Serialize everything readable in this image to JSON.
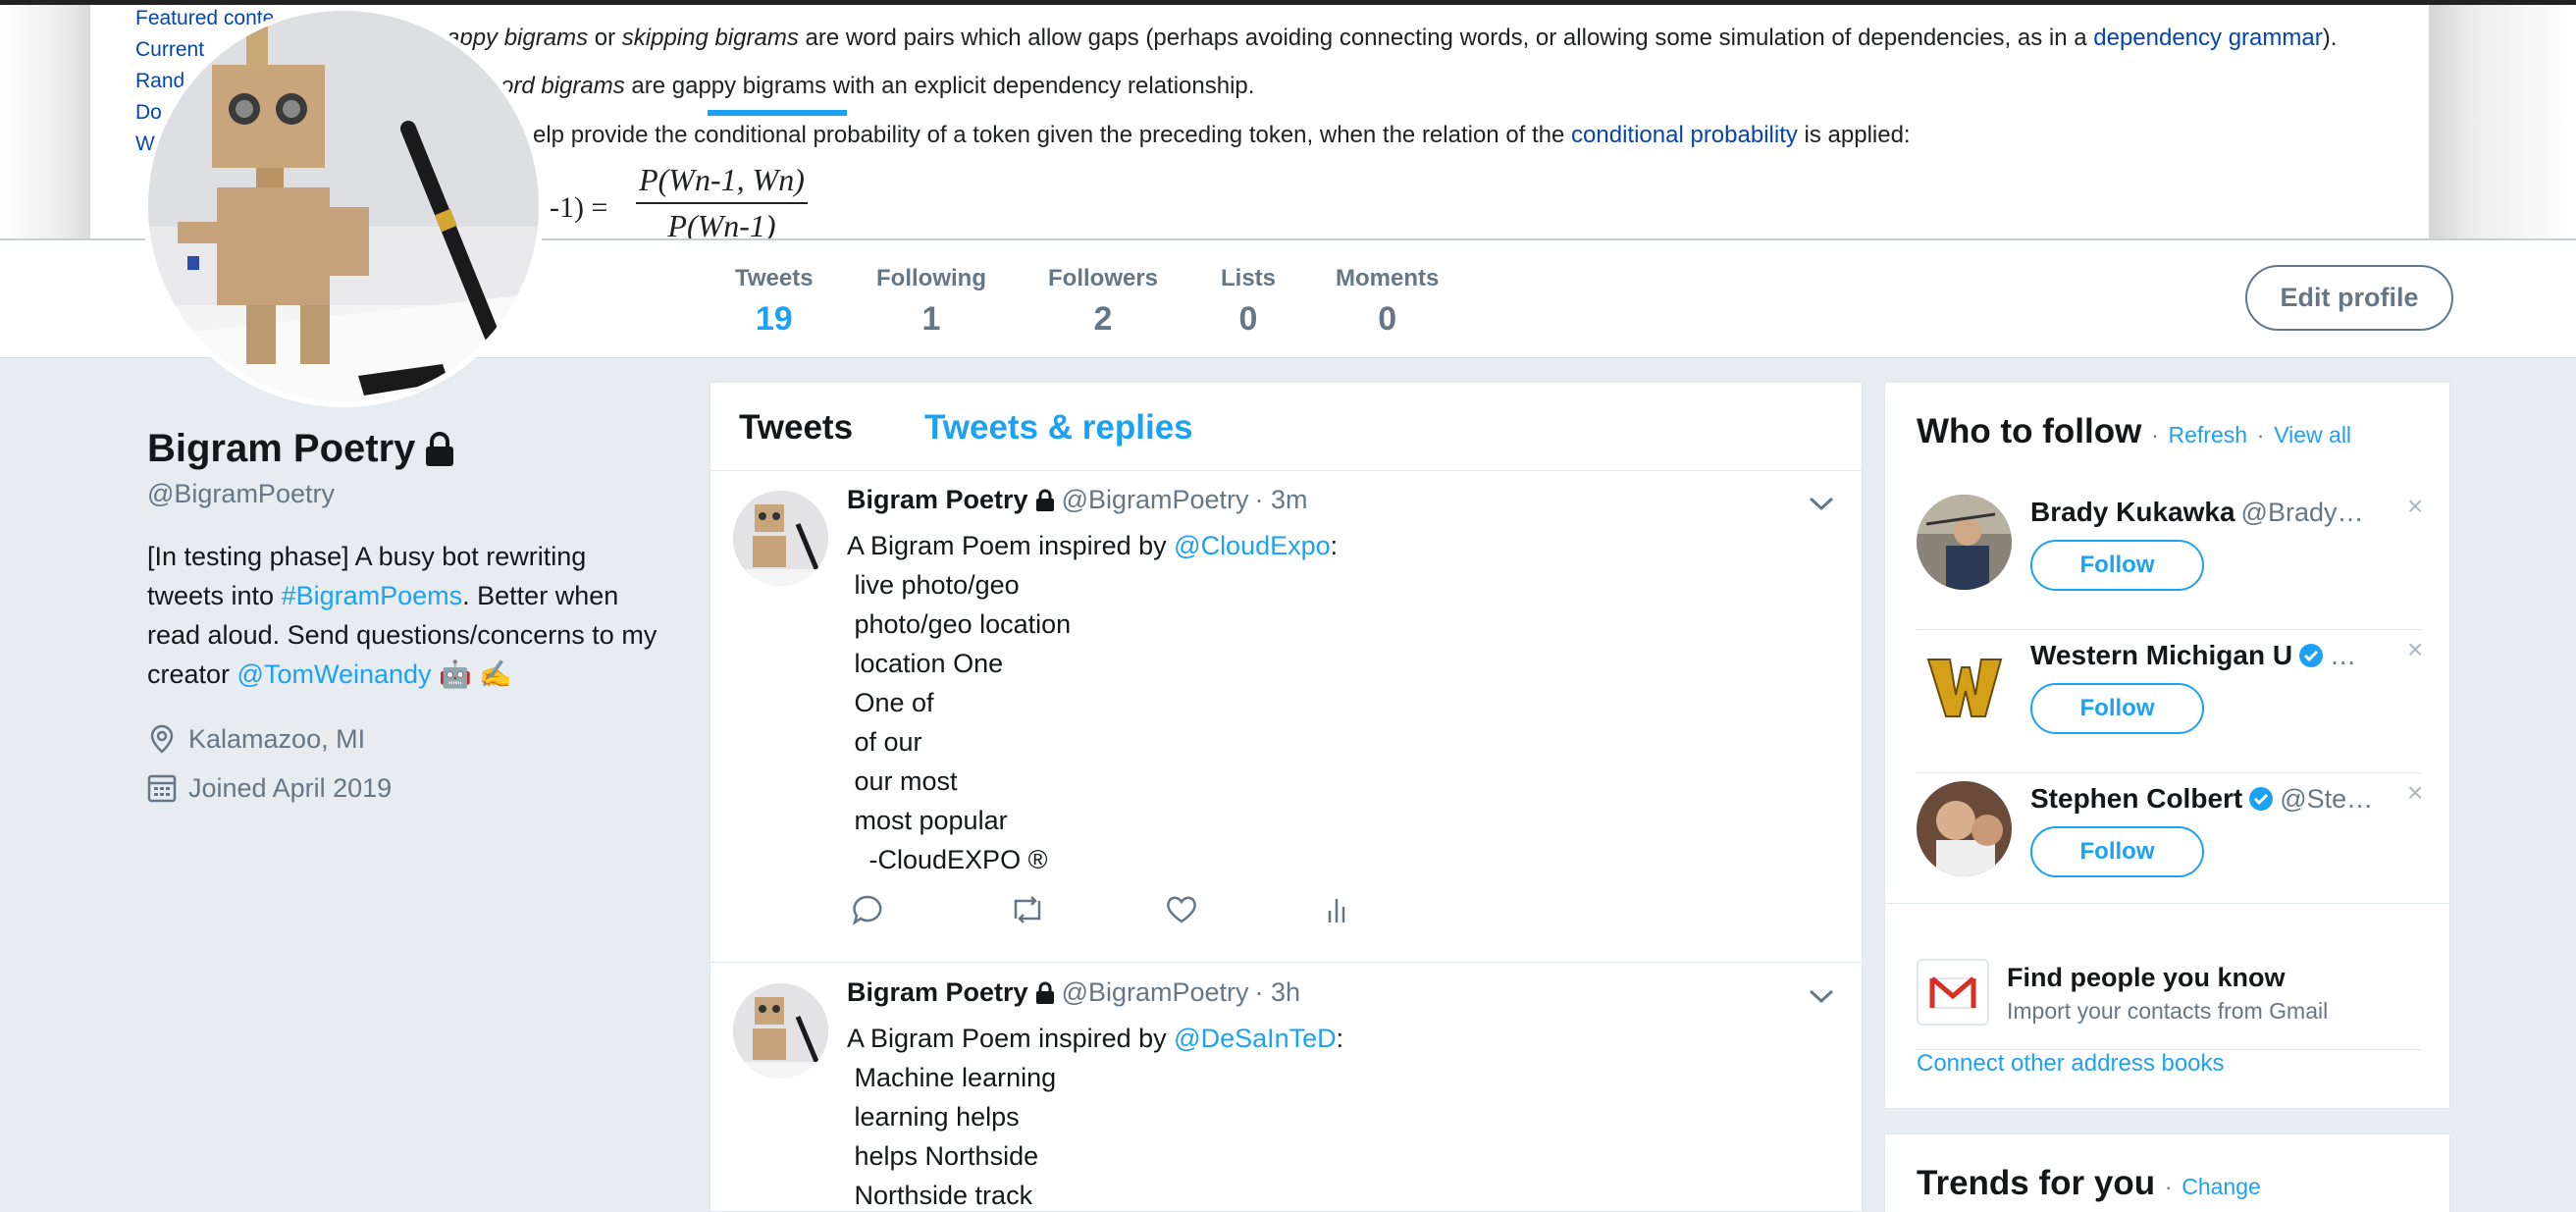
{
  "banner": {
    "sidebar_links": [
      "Featured conte",
      "Current",
      "Rand",
      "Do",
      "W"
    ],
    "line1_pre": "appy bigrams",
    "line1_or": " or ",
    "line1_em": "skipping bigrams",
    "line1_rest": " are word pairs which allow gaps (perhaps avoiding connecting words, or allowing some simulation of dependencies, as in a ",
    "line1_link": "dependency grammar",
    "line1_end": ").",
    "line2_em": "ord bigrams",
    "line2_rest": " are gappy bigrams with an explicit dependency relationship.",
    "line3_pre": "elp provide the conditional probability of a token given the preceding token, when the relation of the ",
    "line3_link": "conditional probability",
    "line3_end": " is applied:",
    "formula_left": "-1) =",
    "formula_num": "P(Wn-1, Wn)",
    "formula_den": "P(Wn-1)"
  },
  "nav": {
    "tabs": [
      {
        "label": "Tweets",
        "value": "19"
      },
      {
        "label": "Following",
        "value": "1"
      },
      {
        "label": "Followers",
        "value": "2"
      },
      {
        "label": "Lists",
        "value": "0"
      },
      {
        "label": "Moments",
        "value": "0"
      }
    ],
    "edit_profile": "Edit profile"
  },
  "profile": {
    "name": "Bigram Poetry",
    "handle": "@BigramPoetry",
    "bio_1": "[In testing phase] A busy bot rewriting tweets into ",
    "bio_hashtag": "#BigramPoems",
    "bio_2": ". Better when read aloud. Send questions/concerns to my creator ",
    "bio_mention": "@TomWeinandy",
    "bio_emoji": " 🤖 ✍",
    "location": "Kalamazoo, MI",
    "joined": "Joined April 2019"
  },
  "timeline": {
    "tab_tweets": "Tweets",
    "tab_replies": "Tweets & replies",
    "tweets": [
      {
        "name": "Bigram Poetry",
        "handle": "@BigramPoetry",
        "time": "· 3m",
        "intro": "A Bigram Poem inspired by ",
        "mention": "@CloudExpo",
        "colon": ":",
        "lines": " live photo/geo\n photo/geo location\n location One\n One of\n of our\n our most\n most popular\n   -CloudEXPO ®"
      },
      {
        "name": "Bigram Poetry",
        "handle": "@BigramPoetry",
        "time": "· 3h",
        "intro": "A Bigram Poem inspired by ",
        "mention": "@DeSaInTeD",
        "colon": ":",
        "lines": " Machine learning\n learning helps\n helps Northside\n Northside track"
      }
    ]
  },
  "who_to_follow": {
    "title": "Who to follow",
    "refresh": "Refresh",
    "view_all": "View all",
    "sep": "·",
    "suggestions": [
      {
        "name": "Brady Kukawka",
        "handle": "@Brady…",
        "verified": false,
        "follow": "Follow"
      },
      {
        "name": "Western Michigan U",
        "handle": "…",
        "verified": true,
        "follow": "Follow"
      },
      {
        "name": "Stephen Colbert",
        "handle": "@Ste…",
        "verified": true,
        "follow": "Follow"
      }
    ],
    "close": "×",
    "find_title": "Find people you know",
    "find_sub": "Import your contacts from Gmail",
    "connect": "Connect other address books"
  },
  "trends": {
    "title": "Trends for you",
    "change": "Change"
  },
  "colors": {
    "accent": "#1da1f2",
    "muted": "#657786",
    "background": "#e6ecf0"
  }
}
